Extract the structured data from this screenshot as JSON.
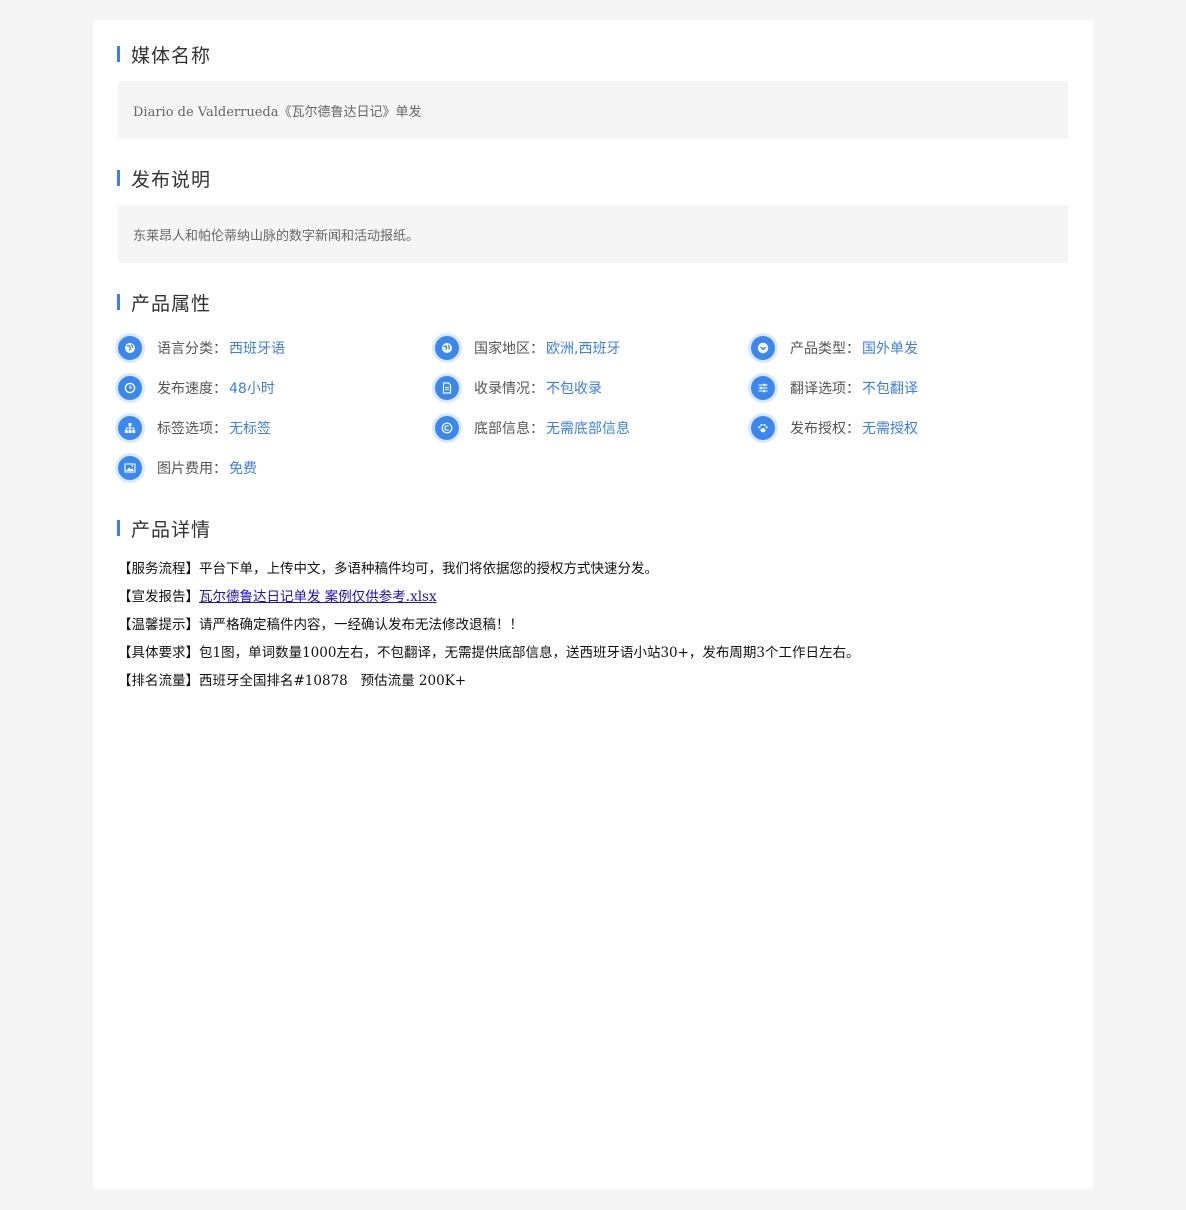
{
  "media_name": {
    "title": "媒体名称",
    "value": "Diario de Valderrueda《瓦尔德鲁达日记》单发"
  },
  "release_note": {
    "title": "发布说明",
    "value": "东莱昂人和帕伦蒂纳山脉的数字新闻和活动报纸。"
  },
  "attributes": {
    "title": "产品属性",
    "items": [
      {
        "label": "语言分类：",
        "value": "西班牙语",
        "icon": "globe-icon"
      },
      {
        "label": "国家地区：",
        "value": "欧洲,西班牙",
        "icon": "earth-icon"
      },
      {
        "label": "产品类型：",
        "value": "国外单发",
        "icon": "chevron-circle-down-icon"
      },
      {
        "label": "发布速度：",
        "value": "48小时",
        "icon": "clock-icon"
      },
      {
        "label": "收录情况：",
        "value": "不包收录",
        "icon": "document-icon"
      },
      {
        "label": "翻译选项：",
        "value": "不包翻译",
        "icon": "sliders-icon"
      },
      {
        "label": "标签选项：",
        "value": "无标签",
        "icon": "sitemap-icon"
      },
      {
        "label": "底部信息：",
        "value": "无需底部信息",
        "icon": "copyright-icon"
      },
      {
        "label": "发布授权：",
        "value": "无需授权",
        "icon": "paw-icon"
      },
      {
        "label": "图片费用：",
        "value": "免费",
        "icon": "image-icon"
      }
    ]
  },
  "details": {
    "title": "产品详情",
    "service_flow": "【服务流程】平台下单，上传中文，多语种稿件均可，我们将依据您的授权方式快速分发。",
    "report_prefix": "【宣发报告】",
    "report_link": "瓦尔德鲁达日记单发 案例仅供参考.xlsx",
    "warning": "【温馨提示】请严格确定稿件内容，一经确认发布无法修改退稿！！",
    "requirements": "【具体要求】包1图，单词数量1000左右，不包翻译，无需提供底部信息，送西班牙语小站30+，发布周期3个工作日左右。",
    "ranking": "【排名流量】西班牙全国排名#10878   预估流量 200K+"
  },
  "colors": {
    "accent": "#3d7ee8",
    "icon_bg": "#3b87f0",
    "page_bg": "#f5f5f5",
    "box_bg": "#f5f5f5",
    "link": "#1a10c8"
  }
}
